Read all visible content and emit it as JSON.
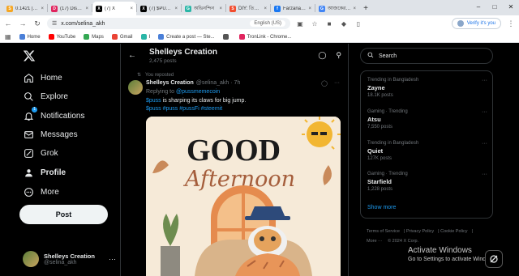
{
  "tabs": [
    {
      "title": "0.1421 | STE",
      "icon": "steem-icon",
      "color": "#f5a623",
      "glyph": "S"
    },
    {
      "title": "(17) Discord",
      "icon": "discord-icon",
      "color": "#e0245e",
      "glyph": "D"
    },
    {
      "title": "(7) X",
      "icon": "x-icon",
      "color": "#000000",
      "glyph": "X",
      "active": true
    },
    {
      "title": "(7) $PUSS o",
      "icon": "x-icon",
      "color": "#000000",
      "glyph": "X"
    },
    {
      "title": "অভিনন্দিন",
      "icon": "grok-icon",
      "color": "#2ab6a7",
      "glyph": "G"
    },
    {
      "title": "DIY: তিনরং",
      "icon": "steem-icon",
      "color": "#f24c2e",
      "glyph": "S"
    },
    {
      "title": "Farzana me",
      "icon": "facebook-icon",
      "color": "#1877f2",
      "glyph": "f"
    },
    {
      "title": "আজকের আ",
      "icon": "google-icon",
      "color": "#4285f4",
      "glyph": "G"
    }
  ],
  "address": {
    "url": "x.com/selina_akh",
    "pill": "English (US)",
    "profile_label": "Verify it's you"
  },
  "bookmarks": [
    {
      "label": "Home",
      "icon": "home-icon",
      "color": "#4a7fd8"
    },
    {
      "label": "YouTube",
      "icon": "youtube-icon",
      "color": "#ff0000"
    },
    {
      "label": "Maps",
      "icon": "maps-icon",
      "color": "#34a853"
    },
    {
      "label": "Gmail",
      "icon": "gmail-icon",
      "color": "#ea4335"
    },
    {
      "label": "I",
      "icon": "grok-icon",
      "color": "#2ab6a7"
    },
    {
      "label": "Create a post — Ste...",
      "icon": "steem-icon",
      "color": "#4a7fd8"
    },
    {
      "label": "",
      "icon": "globe-icon",
      "color": "#555555"
    },
    {
      "label": "TronLink - Chrome...",
      "icon": "tronlink-icon",
      "color": "#e0245e"
    }
  ],
  "nav": {
    "items": [
      {
        "label": "Home",
        "icon": "home-icon"
      },
      {
        "label": "Explore",
        "icon": "search-icon"
      },
      {
        "label": "Notifications",
        "icon": "bell-icon",
        "badge": "1"
      },
      {
        "label": "Messages",
        "icon": "envelope-icon"
      },
      {
        "label": "Grok",
        "icon": "grok-icon"
      },
      {
        "label": "Profile",
        "icon": "person-icon"
      },
      {
        "label": "More",
        "icon": "more-circle-icon"
      }
    ],
    "post_label": "Post",
    "account_name": "Shelleys Creation",
    "account_handle": "@selina_akh"
  },
  "profile_header": {
    "name": "Shelleys Creation",
    "posts": "2,475 posts"
  },
  "post": {
    "repost_text": "You reposted",
    "author": "Shelleys Creation",
    "handle": "@selina_akh · 7h",
    "reply_prefix": "Replying to",
    "reply_to": "@pussmemecoin",
    "text_tag": "$puss",
    "text_body": " is sharping its claws for big jump.",
    "hashtags": "$puss #puss #pussFi #steemit",
    "image_title_1": "GOOD",
    "image_title_2": "Afternoon"
  },
  "sidebar": {
    "search_placeholder": "Search",
    "trends": [
      {
        "context": "Trending in Bangladesh",
        "name": "Zayne",
        "count": "18.1K posts"
      },
      {
        "context": "Gaming · Trending",
        "name": "Atsu",
        "count": "7,550 posts"
      },
      {
        "context": "Trending in Bangladesh",
        "name": "Quiet",
        "count": "127K posts"
      },
      {
        "context": "Gaming · Trending",
        "name": "Starfield",
        "count": "1,228 posts"
      }
    ],
    "show_more": "Show more",
    "footer": [
      "Terms of Service",
      "Privacy Policy",
      "Cookie Policy",
      "More ···",
      "© 2024 X Corp."
    ],
    "activate_title": "Activate Windows",
    "activate_sub": "Go to Settings to activate Windows."
  }
}
